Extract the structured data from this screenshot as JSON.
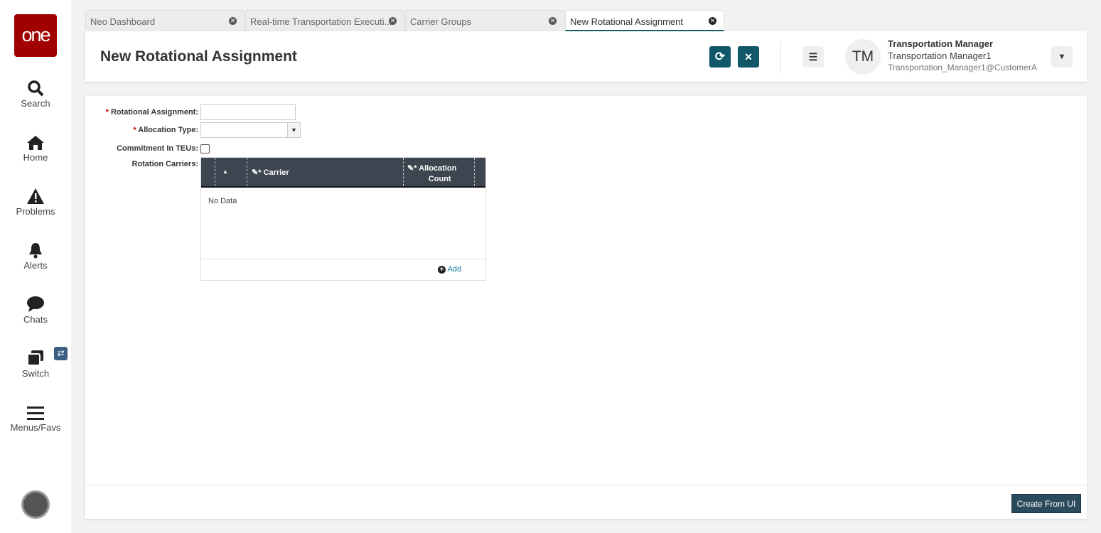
{
  "sidebar": {
    "logo": "one",
    "items": [
      {
        "label": "Search"
      },
      {
        "label": "Home"
      },
      {
        "label": "Problems"
      },
      {
        "label": "Alerts"
      },
      {
        "label": "Chats"
      },
      {
        "label": "Switch"
      },
      {
        "label": "Menus/Favs"
      }
    ],
    "switch_badge": "⇄"
  },
  "tabs": [
    {
      "label": "Neo Dashboard"
    },
    {
      "label": "Real-time Transportation Executi..."
    },
    {
      "label": "Carrier Groups"
    },
    {
      "label": "New Rotational Assignment"
    }
  ],
  "header": {
    "title": "New Rotational Assignment",
    "refresh_icon": "⟳",
    "close_icon": "✕",
    "user_initials": "TM",
    "user_role": "Transportation Manager",
    "user_name": "Transportation Manager1",
    "user_email": "Transportation_Manager1@CustomerA"
  },
  "form": {
    "required_mark": "*",
    "rotational_assignment_label": "Rotational Assignment:",
    "rotational_assignment_value": "",
    "allocation_type_label": "Allocation Type:",
    "allocation_type_value": "",
    "commitment_label": "Commitment In TEUs:",
    "rotation_carriers_label": "Rotation Carriers:"
  },
  "grid": {
    "columns": [
      "Carrier",
      "Allocation",
      "Count"
    ],
    "empty_text": "No Data",
    "add_label": "Add"
  },
  "footer": {
    "create_label": "Create From UI"
  }
}
